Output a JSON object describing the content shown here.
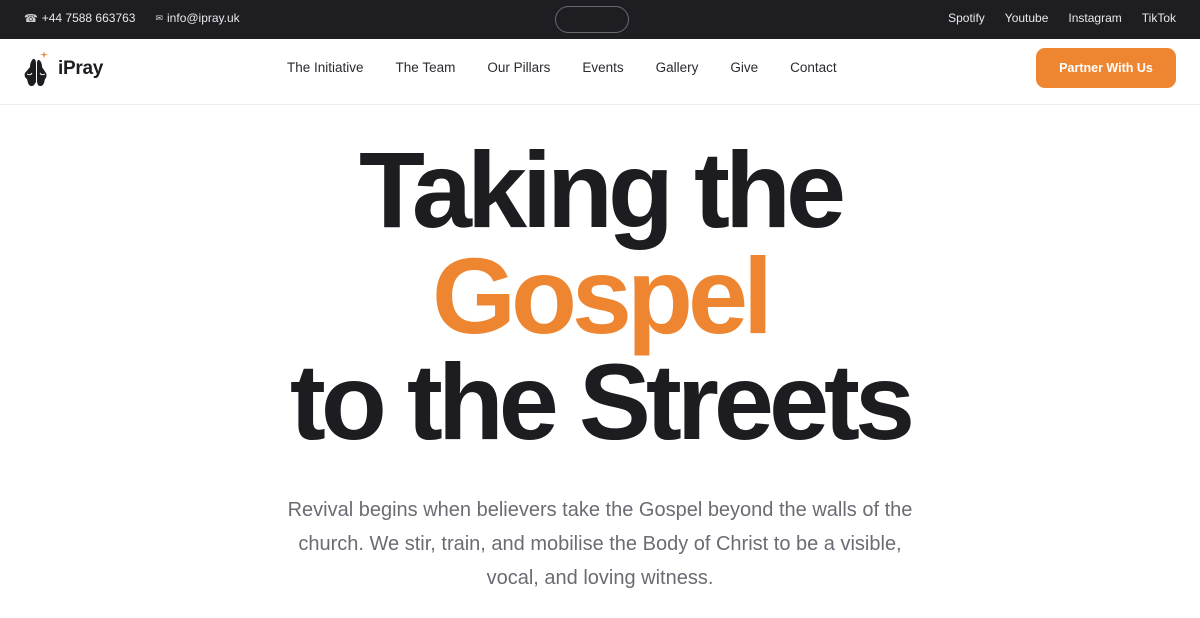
{
  "topbar": {
    "phone_icon": "phone-icon",
    "phone": "+44 7588 663763",
    "email_icon": "mail-icon",
    "email": "info@ipray.uk",
    "social": [
      "Spotify",
      "Youtube",
      "Instagram",
      "TikTok"
    ]
  },
  "brand": {
    "name": "iPray",
    "logo_icon": "praying-hands-icon"
  },
  "nav": {
    "items": [
      "The Initiative",
      "The Team",
      "Our Pillars",
      "Events",
      "Gallery",
      "Give",
      "Contact"
    ],
    "cta": "Partner With Us"
  },
  "hero": {
    "line1": "Taking the",
    "line2": "Gospel",
    "line3": "to the Streets",
    "subtitle": "Revival begins when believers take the Gospel beyond the walls of the church. We stir, train, and mobilise the Body of Christ to be a visible, vocal, and loving witness."
  },
  "colors": {
    "accent": "#ee8631",
    "topbar_bg": "#1d1d22",
    "text_dark": "#1c1c21",
    "text_muted": "#6b6b74"
  }
}
